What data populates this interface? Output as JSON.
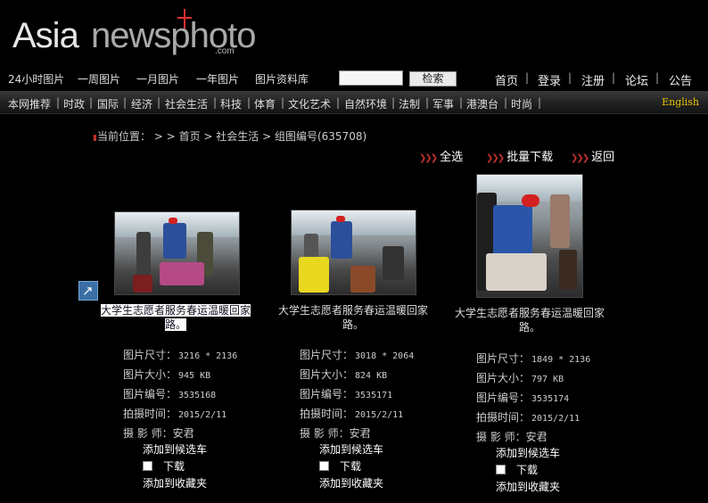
{
  "logo": {
    "asia": "Asia",
    "news": "newsphoto",
    "com": ".com"
  },
  "nav1": {
    "links": [
      "24小时图片",
      "一周图片",
      "一月图片",
      "一年图片",
      "图片资料库"
    ],
    "search_button": "检索",
    "right_links": [
      "首页",
      "登录",
      "注册",
      "论坛",
      "公告"
    ]
  },
  "categories": [
    "本网推荐",
    "时政",
    "国际",
    "经济",
    "社会生活",
    "科技",
    "体育",
    "文化艺术",
    "自然环境",
    "法制",
    "军事",
    "港澳台",
    "时尚"
  ],
  "english_link": "English",
  "breadcrumb": {
    "label": "当前位置：",
    "sep": "> >",
    "items": [
      "首页",
      "社会生活",
      "组图编号(635708)"
    ]
  },
  "actions": {
    "select_all": "全选",
    "batch_download": "批量下载",
    "back": "返回"
  },
  "meta_labels": {
    "size": "图片尺寸：",
    "filesize": "图片大小：",
    "id": "图片编号：",
    "time": "拍摄时间：",
    "photographer": "摄 影 师："
  },
  "option_labels": {
    "add_cart": "添加到候选车",
    "download": "下载",
    "add_fav": "添加到收藏夹"
  },
  "photos": [
    {
      "caption": "大学生志愿者服务春运温暖回家路。",
      "size": "3216 * 2136",
      "filesize": "945 KB",
      "id": "3535168",
      "time": "2015/2/11",
      "photographer": "安君"
    },
    {
      "caption": "大学生志愿者服务春运温暖回家路。",
      "size": "3018 * 2064",
      "filesize": "824 KB",
      "id": "3535171",
      "time": "2015/2/11",
      "photographer": "安君"
    },
    {
      "caption": "大学生志愿者服务春运温暖回家路。",
      "size": "1849 * 2136",
      "filesize": "797 KB",
      "id": "3535174",
      "time": "2015/2/11",
      "photographer": "安君"
    }
  ],
  "colors": {
    "background": "#000000",
    "accent_red": "#c03030",
    "english_gold": "#e8c200"
  }
}
